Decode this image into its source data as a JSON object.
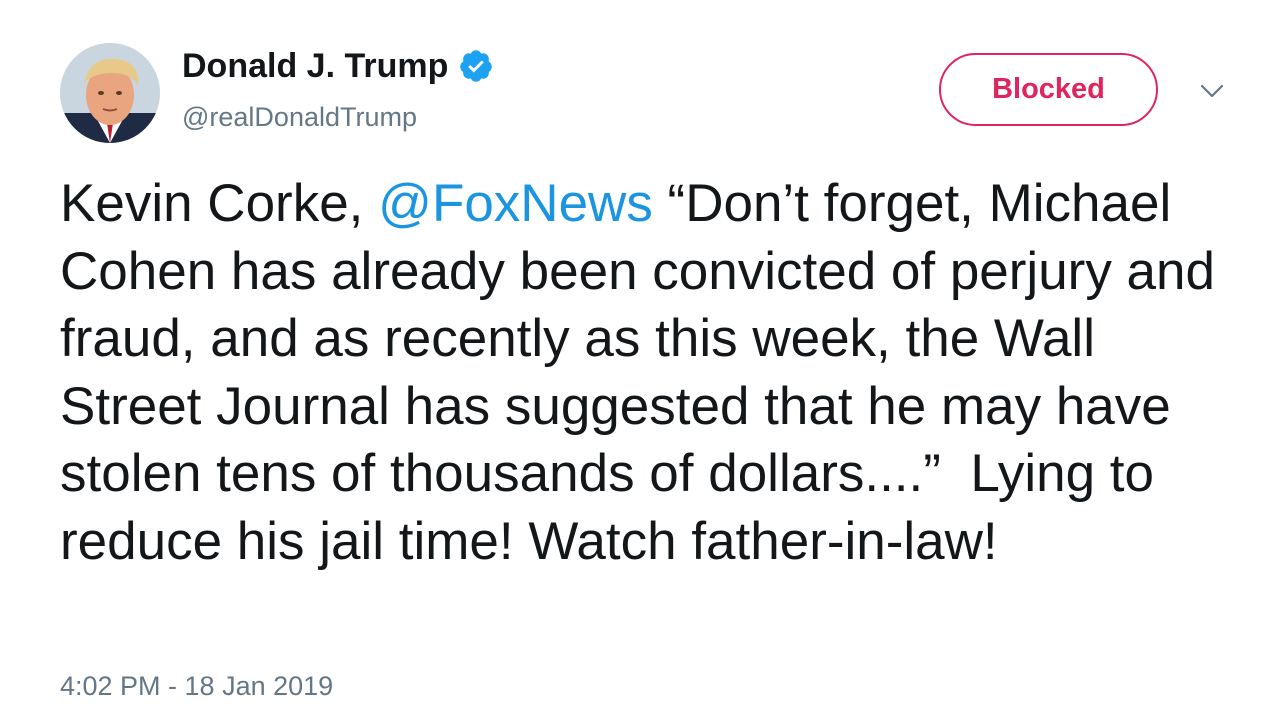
{
  "author": {
    "display_name": "Donald J. Trump",
    "handle": "@realDonaldTrump",
    "verified": true,
    "avatar_icon": "profile-photo"
  },
  "actions": {
    "blocked_label": "Blocked",
    "caret_icon": "chevron-down-icon"
  },
  "tweet": {
    "text_before": "Kevin Corke, ",
    "mention": "@FoxNews",
    "text_after": " “Don’t forget, Michael Cohen has already been convicted of perjury and fraud, and as recently as this week, the Wall Street Journal has suggested that he may have stolen tens of thousands of dollars....”  Lying to reduce his jail time! Watch father-in-law!",
    "timestamp": "4:02 PM - 18 Jan 2019"
  },
  "colors": {
    "blocked": "#e0245e",
    "link": "#1b95e0",
    "verified": "#1da1f2",
    "text": "#14171a",
    "secondary": "#657786"
  }
}
